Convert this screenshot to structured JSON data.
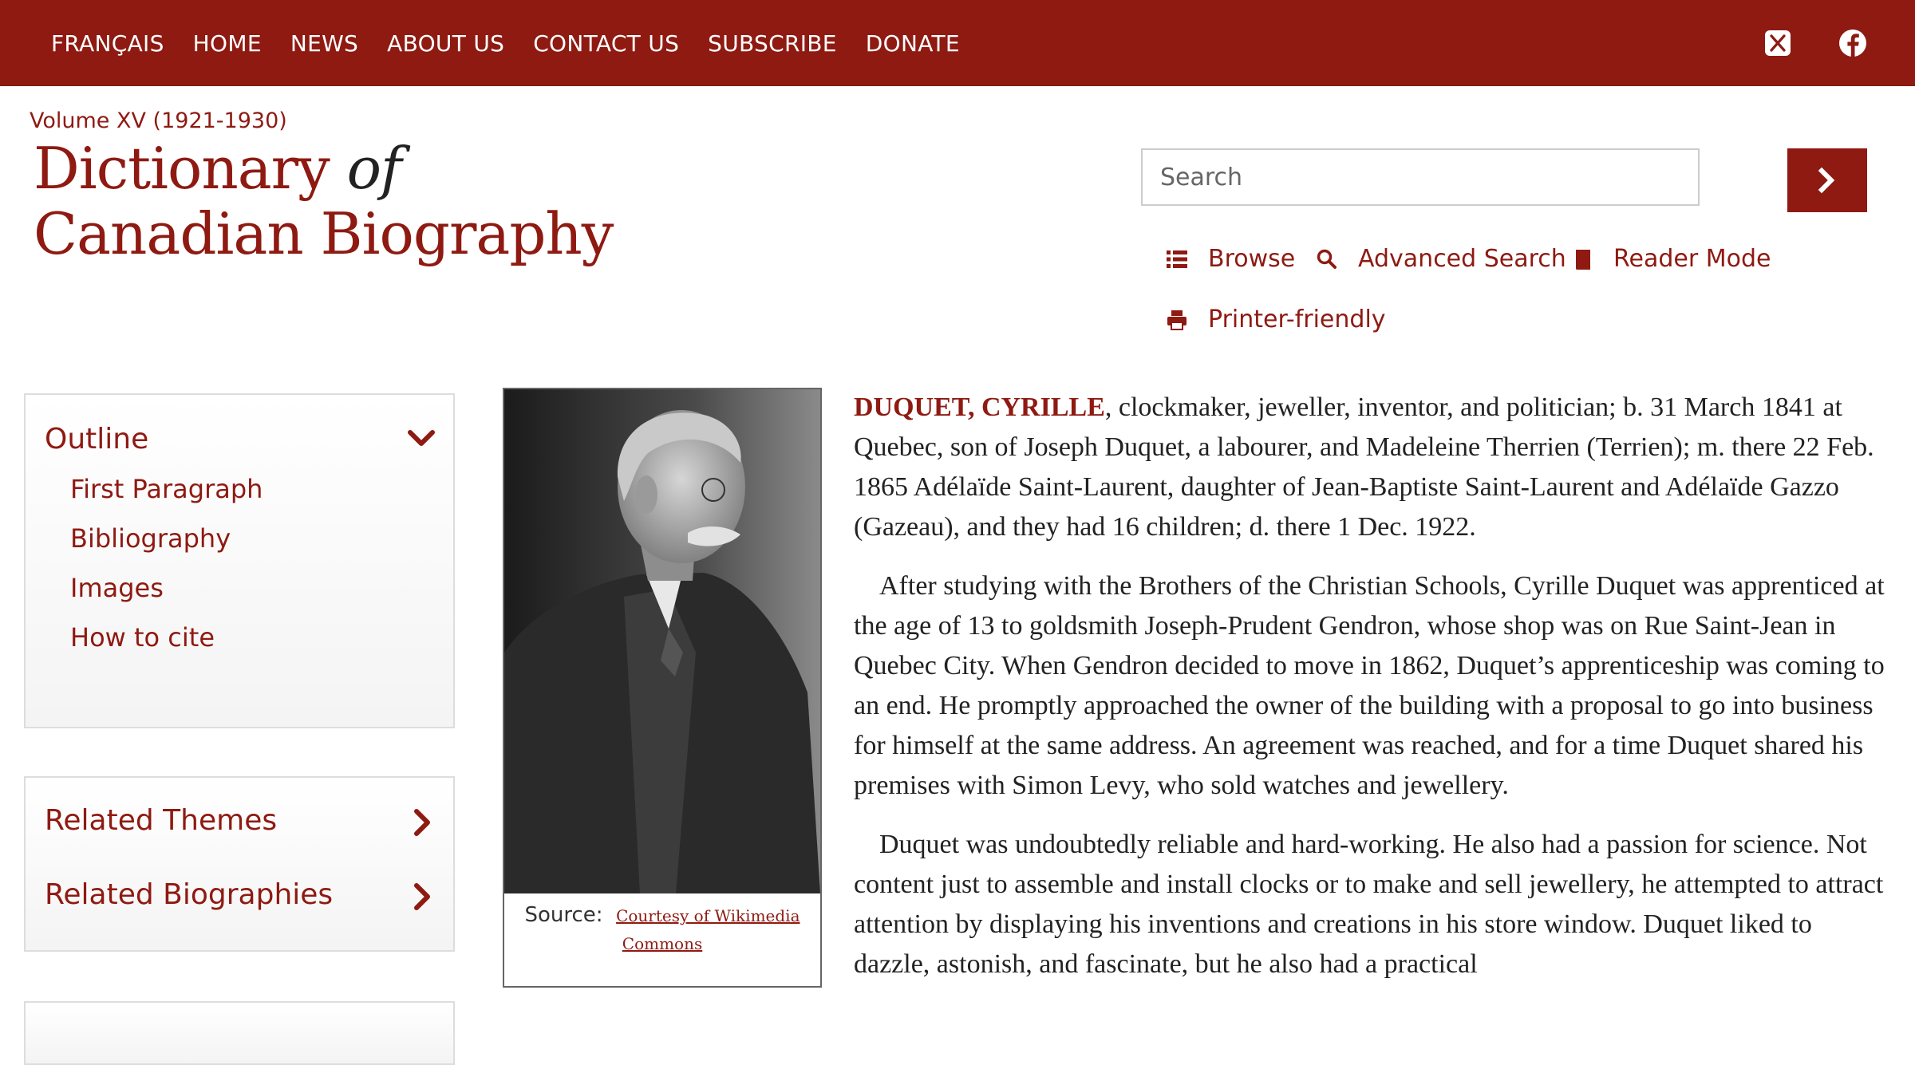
{
  "topnav": {
    "items": [
      "FRANÇAIS",
      "HOME",
      "NEWS",
      "ABOUT US",
      "CONTACT US",
      "SUBSCRIBE",
      "DONATE"
    ]
  },
  "social": {
    "icons": [
      "x-twitter-icon",
      "facebook-icon"
    ]
  },
  "header": {
    "volume": "Volume XV (1921-1930)",
    "title_line1_main": "Dictionary",
    "title_line1_of": "of",
    "title_line2": "Canadian Biography"
  },
  "search": {
    "placeholder": "Search"
  },
  "tools": {
    "browse": "Browse",
    "advanced_search": "Advanced Search",
    "reader_mode": "Reader Mode",
    "printer_friendly": "Printer-friendly"
  },
  "sidebar": {
    "outline_title": "Outline",
    "outline_items": [
      "First Paragraph",
      "Bibliography",
      "Images",
      "How to cite"
    ],
    "related_themes": "Related Themes",
    "related_biographies": "Related Biographies"
  },
  "figure": {
    "source_label": "Source:",
    "source_link_line1": "Courtesy of Wikimedia",
    "source_link_line2": "Commons"
  },
  "article": {
    "subject": "DUQUET, CYRILLE",
    "para1_rest": ", clockmaker, jeweller, inventor, and politician; b. 31 March 1841 at Quebec, son of Joseph Duquet, a labourer, and Madeleine Therrien (Terrien); m. there 22 Feb. 1865 Adélaïde Saint-Laurent, daughter of Jean-Baptiste Saint-Laurent and Adélaïde Gazzo (Gazeau), and they had 16 children; d. there 1 Dec. 1922.",
    "para2": "After studying with the Brothers of the Christian Schools, Cyrille Duquet was apprenticed at the age of 13 to goldsmith Joseph-Prudent Gendron, whose shop was on Rue Saint-Jean in Quebec City. When Gendron decided to move in 1862, Duquet’s apprenticeship was coming to an end. He promptly approached the owner of the building with a proposal to go into business for himself at the same address. An agreement was reached, and for a time Duquet shared his premises with Simon Levy, who sold watches and jewellery.",
    "para3": "Duquet was undoubtedly reliable and hard-working. He also had a passion for science. Not content just to assemble and install clocks or to make and sell jewellery, he attempted to attract attention by displaying his inventions and creations in his store window. Duquet liked to dazzle, astonish, and fascinate, but he also had a practical"
  },
  "colors": {
    "brand": "#8e1a12",
    "text": "#222222",
    "panel_border": "#dddddd"
  }
}
